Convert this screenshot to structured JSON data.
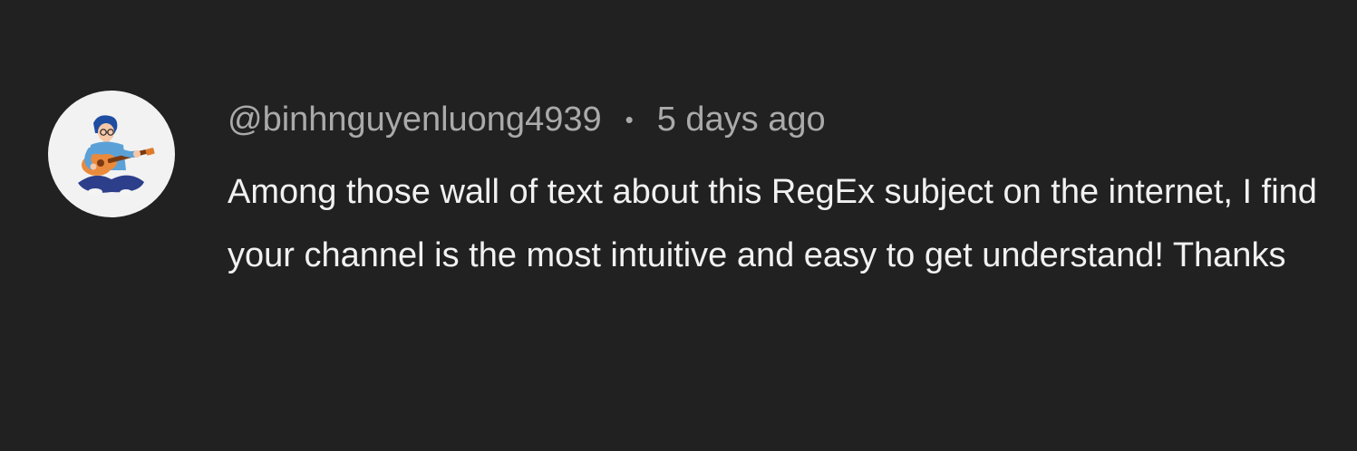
{
  "comment": {
    "author": "@binhnguyenluong4939",
    "separator": "•",
    "timestamp": "5 days ago",
    "text": "Among those wall of text about this RegEx subject on the internet, I find your channel is the most intuitive and easy to get understand! Thanks",
    "avatar_icon": "guitar-player-avatar-icon"
  },
  "colors": {
    "background": "#212121",
    "meta_text": "#aaaaaa",
    "comment_text": "#f1f1f1",
    "avatar_background": "#f2f2f2"
  }
}
